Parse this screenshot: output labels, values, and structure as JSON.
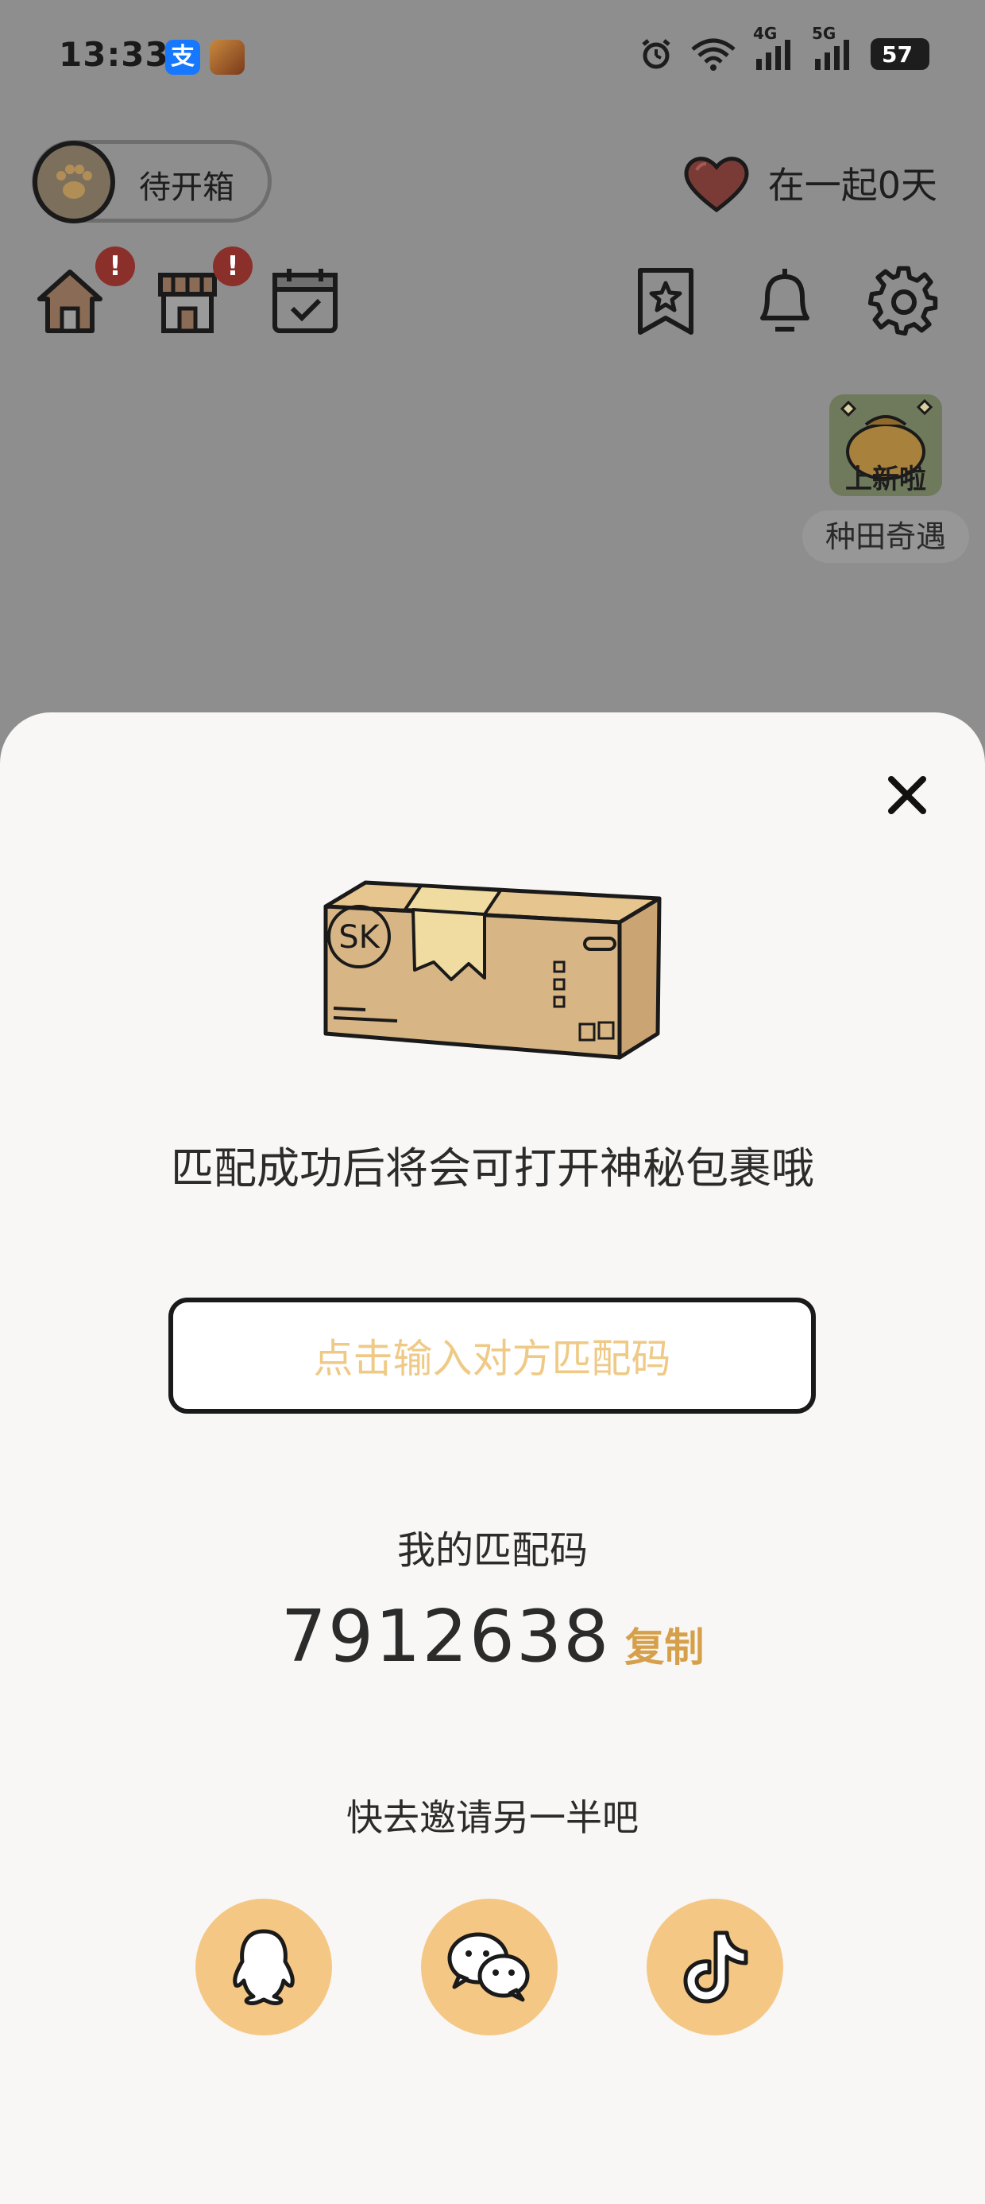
{
  "status_bar": {
    "time": "13:33",
    "alipay_glyph": "支",
    "network_4g": "4G",
    "network_5g": "5G",
    "battery": "57"
  },
  "top_bar": {
    "pill_label": "待开箱",
    "together_text": "在一起0天",
    "badge_text": "!"
  },
  "promo": {
    "banner": "上新啦",
    "label": "种田奇遇"
  },
  "sheet": {
    "box_text": "SK",
    "title": "匹配成功后将会可打开神秘包裹哦",
    "input_placeholder": "点击输入对方匹配码",
    "my_code_label": "我的匹配码",
    "my_code": "7912638",
    "copy_label": "复制",
    "invite_label": "快去邀请另一半吧"
  },
  "colors": {
    "accent": "#d6a04b",
    "placeholder": "#efca86",
    "share_bg": "#f5c784"
  },
  "icons": [
    "house-icon",
    "shop-icon",
    "calendar-icon",
    "bookmark-star-icon",
    "bell-icon",
    "gear-icon",
    "heart-icon",
    "close-icon",
    "qq-icon",
    "wechat-icon",
    "douyin-icon"
  ]
}
